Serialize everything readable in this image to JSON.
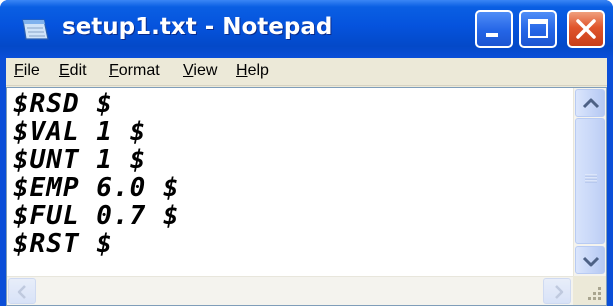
{
  "window": {
    "title": "setup1.txt - Notepad"
  },
  "menu": {
    "items": [
      {
        "label": "File"
      },
      {
        "label": "Edit"
      },
      {
        "label": "Format"
      },
      {
        "label": "View"
      },
      {
        "label": "Help"
      }
    ]
  },
  "document": {
    "lines": [
      "$RSD $",
      "$VAL 1 $",
      "$UNT 1 $",
      "$EMP 6.0 $",
      "$FUL 0.7 $",
      "$RST $"
    ]
  },
  "icons": {
    "app": "notepad-icon",
    "minimize": "minimize-icon",
    "maximize": "maximize-icon",
    "close": "close-icon",
    "scroll_up": "arrow-up-icon",
    "scroll_down": "arrow-down-icon",
    "scroll_left": "arrow-left-icon",
    "scroll_right": "arrow-right-icon",
    "resize": "resize-grip-icon"
  },
  "colors": {
    "titlebar": "#0553dd",
    "close_button": "#e0552c",
    "client_background": "#ece9d8"
  },
  "scrollbars": {
    "vertical_position": 0
  }
}
